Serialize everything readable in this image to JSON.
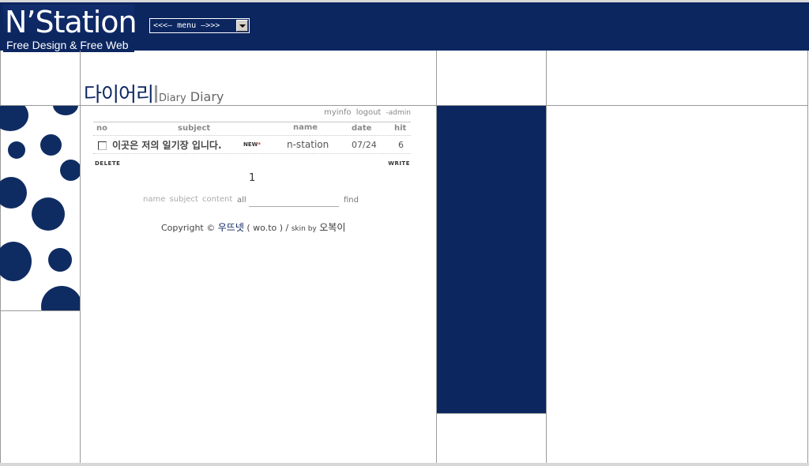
{
  "header": {
    "logo_main": "N’Station",
    "logo_sub": "Free Design & Free Web",
    "menu_select": "<<<— menu —>>>"
  },
  "colors": {
    "navy": "#0c2660",
    "divider": "#9a9a9a"
  },
  "page": {
    "title_korean": "다이어리",
    "title_en_small": "Diary",
    "title_en_large": "Diary"
  },
  "board": {
    "links": {
      "myinfo": "myinfo",
      "logout": "logout",
      "admin": "-admin"
    },
    "columns": {
      "no": "no",
      "subject": "subject",
      "name": "name",
      "date": "date",
      "hit": "hit"
    },
    "rows": [
      {
        "subject": "이곳은 저의 일기장 입니다.",
        "new_badge": "NEW",
        "new_mark": "*",
        "name": "n-station",
        "date": "07/24",
        "hit": "6"
      }
    ],
    "delete_label": "DELETE",
    "write_label": "WRITE",
    "current_page": "1",
    "search": {
      "opt_name": "name",
      "opt_subject": "subject",
      "opt_content": "content",
      "opt_all": "all",
      "value": "",
      "find_label": "find"
    },
    "copyright": {
      "prefix": "Copyright ©",
      "site": "우뜨넷",
      "domain": "( wo.to ) /",
      "skin_by": "skin by",
      "author": "오복이"
    }
  }
}
